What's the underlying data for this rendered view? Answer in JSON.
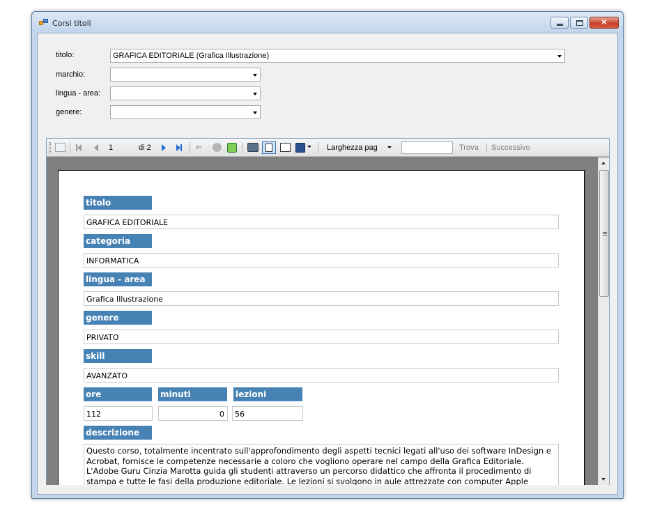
{
  "window": {
    "title": "Corsi titoli"
  },
  "filters": {
    "titolo_label": "titolo:",
    "titolo_value": "GRAFICA EDITORIALE (Grafica Illustrazione)",
    "marchio_label": "marchio:",
    "marchio_value": "",
    "lingua_label": "lingua - area:",
    "lingua_value": "",
    "genere_label": "genere:",
    "genere_value": ""
  },
  "toolbar": {
    "current_page": "1",
    "of_pages": "di 2",
    "zoom": "Larghezza pag",
    "search_value": "",
    "find_label": "Trova",
    "next_label": "Successivo"
  },
  "report": {
    "titolo_header": "titolo",
    "titolo_value": "GRAFICA EDITORIALE",
    "categoria_header": "categoria",
    "categoria_value": "INFORMATICA",
    "lingua_header": "lingua - area",
    "lingua_value": "Grafica Illustrazione",
    "genere_header": "genere",
    "genere_value": "PRIVATO",
    "skill_header": "skill",
    "skill_value": "AVANZATO",
    "ore_header": "ore",
    "ore_value": "112",
    "minuti_header": "minuti",
    "minuti_value": "0",
    "lezioni_header": "lezioni",
    "lezioni_value": "56",
    "descrizione_header": "descrizione",
    "descrizione_value": "Questo corso, totalmente incentrato sull'approfondimento degli aspetti tecnici legati all'uso dei software InDesign e Acrobat, fornisce le competenze necessarie a coloro che vogliono operare nel campo della Grafica Editoriale. L'Adobe Guru Cinzia Marotta guida gli studenti attraverso un percorso didattico che affronta il procedimento di stampa e tutte le fasi della produzione editoriale. Le lezioni si svolgono in aule attrezzate con computer Apple MacIntosh utilizzando il"
  },
  "colors": {
    "label_bg": "#4682b4",
    "window_frame": "#c4d7ec",
    "close_button": "#c6432a"
  }
}
